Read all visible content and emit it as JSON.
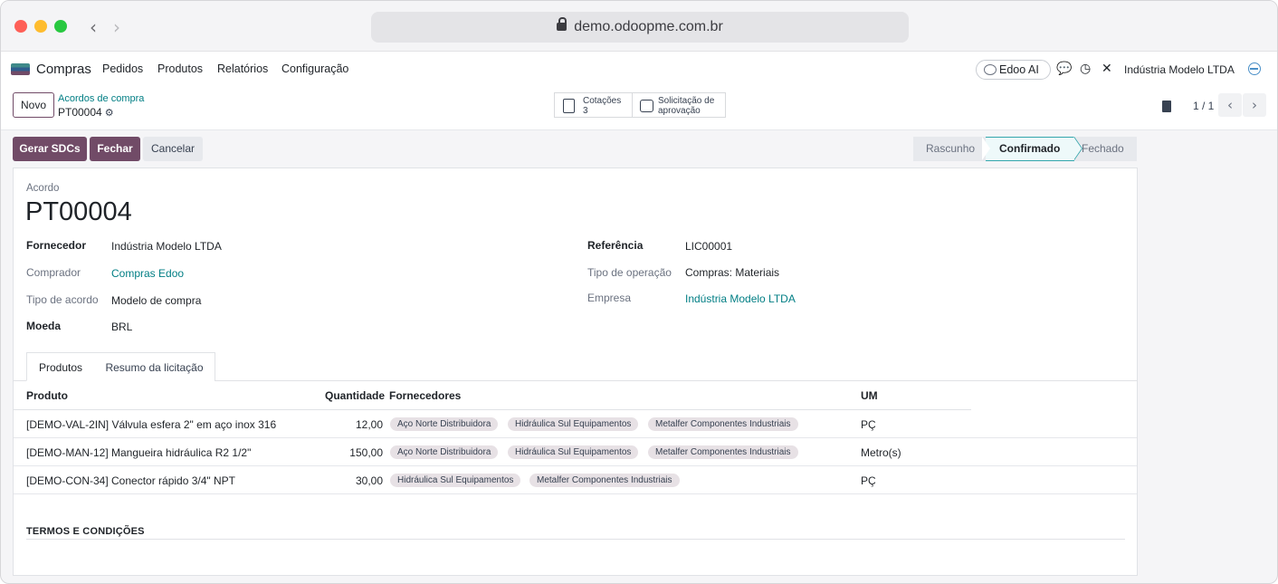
{
  "browser": {
    "url": "demo.odoopme.com.br"
  },
  "app": {
    "name": "Compras",
    "menu": [
      "Pedidos",
      "Produtos",
      "Relatórios",
      "Configuração"
    ],
    "ai_label": "Edoo AI",
    "company": "Indústria Modelo LTDA"
  },
  "control": {
    "new_label": "Novo",
    "breadcrumb_parent": "Acordos de compra",
    "breadcrumb_current": "PT00004",
    "smart_buttons": [
      {
        "line1": "Cotações",
        "line2": "3"
      },
      {
        "line1": "Solicitação de",
        "line2": "aprovação"
      }
    ],
    "pager": "1 / 1"
  },
  "actions": {
    "generate": "Gerar SDCs",
    "close": "Fechar",
    "cancel": "Cancelar"
  },
  "status": {
    "stages": [
      "Rascunho",
      "Confirmado",
      "Fechado"
    ],
    "active": "Confirmado"
  },
  "record": {
    "kind_label": "Acordo",
    "name": "PT00004",
    "fields_left": [
      {
        "label": "Fornecedor",
        "value": "Indústria Modelo LTDA"
      },
      {
        "label": "Comprador",
        "value": "Compras Edoo"
      },
      {
        "label": "Tipo de acordo",
        "value": "Modelo de compra"
      },
      {
        "label": "Moeda",
        "value": "BRL"
      }
    ],
    "fields_right": [
      {
        "label": "Referência",
        "value": "LIC00001"
      },
      {
        "label": "Tipo de operação",
        "value": "Compras: Materiais"
      },
      {
        "label": "Empresa",
        "value": "Indústria Modelo LTDA"
      }
    ]
  },
  "tabs": [
    "Produtos",
    "Resumo da licitação"
  ],
  "lines": {
    "headers": [
      "Produto",
      "Quantidade",
      "Fornecedores",
      "UM"
    ],
    "rows": [
      {
        "product": "[DEMO-VAL-2IN] Válvula esfera 2\" em aço inox 316",
        "qty": "12,00",
        "vendors": [
          "Aço Norte Distribuidora",
          "Hidráulica Sul Equipamentos",
          "Metalfer Componentes Industriais"
        ],
        "uom": "PÇ"
      },
      {
        "product": "[DEMO-MAN-12] Mangueira hidráulica R2 1/2\"",
        "qty": "150,00",
        "vendors": [
          "Aço Norte Distribuidora",
          "Hidráulica Sul Equipamentos",
          "Metalfer Componentes Industriais"
        ],
        "uom": "Metro(s)"
      },
      {
        "product": "[DEMO-CON-34] Conector rápido 3/4\" NPT",
        "qty": "30,00",
        "vendors": [
          "Hidráulica Sul Equipamentos",
          "Metalfer Componentes Industriais"
        ],
        "uom": "PÇ"
      }
    ]
  },
  "terms_title": "TERMOS E CONDIÇÕES",
  "colors": {
    "primary": "#714b67",
    "link": "#017e84",
    "tag_bg": "#e7e1e5"
  }
}
